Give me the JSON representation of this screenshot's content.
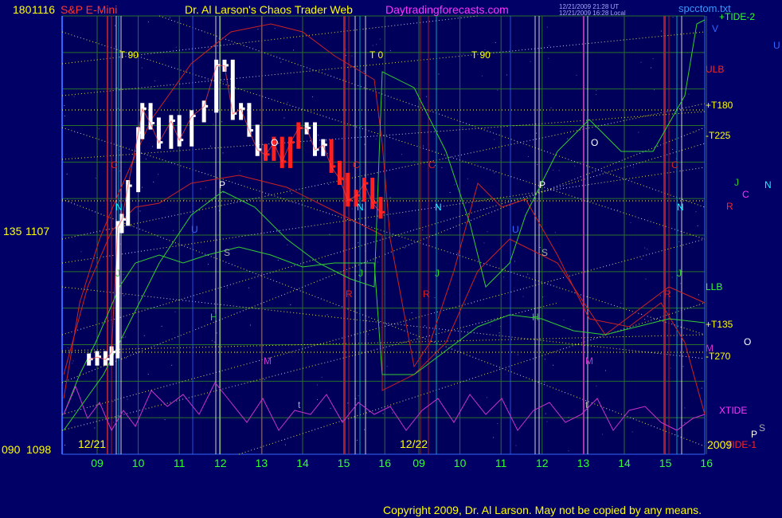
{
  "header": {
    "instrument": "S&P E-Mini",
    "title": "Dr. Al Larson's Chaos Trader Web",
    "site": "Daytradingforecasts.com",
    "timestamp_1": "12/21/2009 21:28 UT",
    "timestamp_2": "12/21/2009 16:28 Local",
    "file": "spcctom.txt"
  },
  "y_axis": {
    "ticks": [
      {
        "angle": "180",
        "price": "1116"
      },
      {
        "angle": "135",
        "price": "1107"
      },
      {
        "angle": "090",
        "price": "1098"
      }
    ]
  },
  "x_axis": {
    "hours": [
      "09",
      "10",
      "11",
      "12",
      "13",
      "14",
      "15",
      "16",
      "09",
      "10",
      "11",
      "12",
      "13",
      "14",
      "15",
      "16"
    ],
    "dates": [
      "12/21",
      "12/22"
    ],
    "year": "2009"
  },
  "cycle_labels": [
    "T  90",
    "T  0",
    "T  90"
  ],
  "right_labels": {
    "tide2": "+TIDE-2",
    "v": "V",
    "u": "U",
    "ulb": "ULB",
    "t180": "+T180",
    "t225": "-T225",
    "j": "J",
    "c": "C",
    "n": "N",
    "r": "R",
    "llb": "LLB",
    "t135": "+T135",
    "m": "M",
    "o": "O",
    "t270": "-T270",
    "xtide": "XTIDE",
    "p": "P",
    "s": "S",
    "tide1": "TIDE-1"
  },
  "chart_letters": {
    "c": "C",
    "n": "N",
    "j": "J",
    "r": "R",
    "h": "H",
    "m": "M",
    "s": "S",
    "p": "P",
    "o": "O",
    "t": "t",
    "u": "U"
  },
  "footer": {
    "copyright": "Copyright 2009, Dr. Al Larson. May not be copied by any means."
  },
  "colors": {
    "background": "#000066",
    "axis_text": "#ffff00",
    "price_bars": "#ffffff",
    "price_bars_red": "#ff2020",
    "xtide": "#cc33cc",
    "green_lines": "#33cc33",
    "red_lines": "#cc2222",
    "yellow_dotted": "#ffff66",
    "hour_labels": "#33ff33",
    "instrument": "#ff3333",
    "site": "#ff33ff"
  },
  "chart_data": {
    "type": "line",
    "title": "S&P E-Mini",
    "x_categories": [
      "09",
      "10",
      "11",
      "12",
      "13",
      "14",
      "15",
      "16",
      "09",
      "10",
      "11",
      "12",
      "13",
      "14",
      "15",
      "16"
    ],
    "dates": [
      "12/21",
      "12/22"
    ],
    "ylim": [
      1098,
      1116
    ],
    "y_ticks": [
      1098,
      1107,
      1116
    ],
    "grid": true,
    "series": [
      {
        "name": "S&P E-Mini",
        "x": [
          8.8,
          9.0,
          9.2,
          9.35,
          9.5,
          9.6,
          9.75,
          10.0,
          10.1,
          10.3,
          10.5,
          10.8,
          11.0,
          11.3,
          11.6,
          11.9,
          12.1,
          12.3,
          12.5,
          12.7,
          12.9,
          13.1,
          13.3,
          13.5,
          13.7,
          13.9,
          14.1,
          14.3,
          14.5,
          14.7,
          14.9,
          15.1,
          15.3,
          15.5,
          15.7,
          15.9
        ],
        "y": [
          1101.8,
          1101.9,
          1101.8,
          1102.1,
          1107.3,
          1107.6,
          1109.0,
          1111.2,
          1112.2,
          1111.6,
          1110.8,
          1111.7,
          1110.9,
          1111.9,
          1112.3,
          1114.0,
          1114.0,
          1112.0,
          1112.2,
          1111.3,
          1110.5,
          1110.3,
          1110.8,
          1110.0,
          1110.8,
          1111.4,
          1111.4,
          1110.5,
          1110.7,
          1109.8,
          1109.3,
          1108.4,
          1108.6,
          1109.1,
          1108.3,
          1107.9
        ]
      }
    ]
  }
}
